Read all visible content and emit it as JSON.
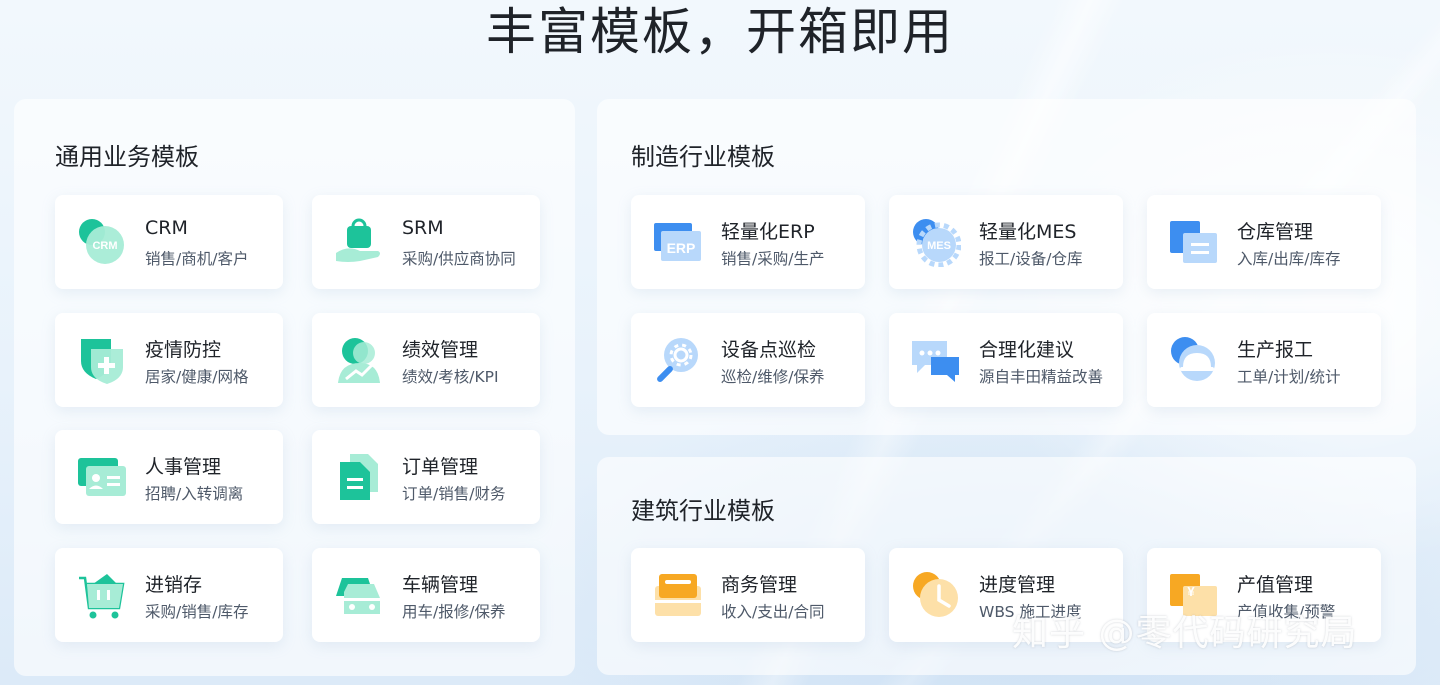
{
  "page": {
    "title": "丰富模板，开箱即用"
  },
  "sections": {
    "general": {
      "title": "通用业务模板",
      "cards": [
        {
          "title": "CRM",
          "subtitle": "销售/商机/客户",
          "icon": "crm-icon",
          "badge": "CRM"
        },
        {
          "title": "SRM",
          "subtitle": "采购/供应商协同",
          "icon": "shopping-bag-hand-icon"
        },
        {
          "title": "疫情防控",
          "subtitle": "居家/健康/网格",
          "icon": "medical-shield-icon"
        },
        {
          "title": "绩效管理",
          "subtitle": "绩效/考核/KPI",
          "icon": "user-growth-icon"
        },
        {
          "title": "人事管理",
          "subtitle": "招聘/入转调离",
          "icon": "id-card-icon"
        },
        {
          "title": "订单管理",
          "subtitle": "订单/销售/财务",
          "icon": "document-icon"
        },
        {
          "title": "进销存",
          "subtitle": "采购/销售/库存",
          "icon": "shopping-cart-icon"
        },
        {
          "title": "车辆管理",
          "subtitle": "用车/报修/保养",
          "icon": "car-icon"
        }
      ]
    },
    "manufacturing": {
      "title": "制造行业模板",
      "cards": [
        {
          "title": "轻量化ERP",
          "subtitle": "销售/采购/生产",
          "icon": "erp-icon",
          "badge": "ERP"
        },
        {
          "title": "轻量化MES",
          "subtitle": "报工/设备/仓库",
          "icon": "mes-gear-icon",
          "badge": "MES"
        },
        {
          "title": "仓库管理",
          "subtitle": "入库/出库/库存",
          "icon": "warehouse-icon"
        },
        {
          "title": "设备点巡检",
          "subtitle": "巡检/维修/保养",
          "icon": "magnifier-gear-icon"
        },
        {
          "title": "合理化建议",
          "subtitle": "源自丰田精益改善",
          "icon": "chat-bubbles-icon"
        },
        {
          "title": "生产报工",
          "subtitle": "工单/计划/统计",
          "icon": "hard-hat-icon"
        }
      ]
    },
    "construction": {
      "title": "建筑行业模板",
      "cards": [
        {
          "title": "商务管理",
          "subtitle": "收入/支出/合同",
          "icon": "briefcase-icon"
        },
        {
          "title": "进度管理",
          "subtitle": "WBS 施工进度",
          "icon": "clock-icon"
        },
        {
          "title": "产值管理",
          "subtitle": "产值收集/预警",
          "icon": "yuan-document-icon",
          "badge": "¥"
        }
      ]
    }
  },
  "watermark": "知乎 @零代码研究局",
  "colors": {
    "green": "#1dc39a",
    "green_light": "#a7ecd6",
    "blue": "#3d8ef0",
    "blue_light": "#b8d8fb",
    "orange": "#f7a823",
    "orange_light": "#fde0a8"
  }
}
